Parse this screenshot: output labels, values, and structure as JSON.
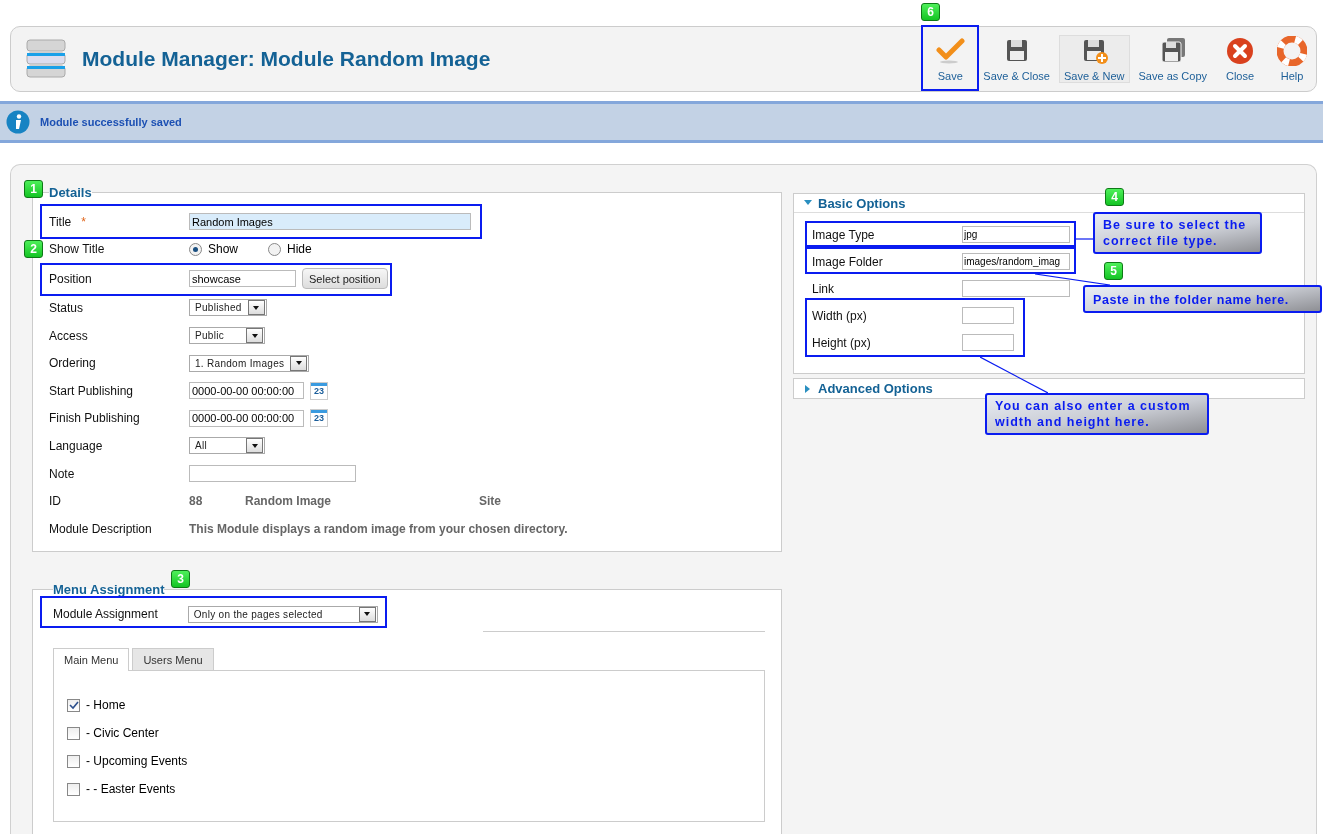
{
  "toolbar": {
    "title": "Module Manager: Module Random Image",
    "buttons": [
      {
        "label": "Save",
        "kind": "save",
        "highlighted": false
      },
      {
        "label": "Save & Close",
        "kind": "save-close",
        "highlighted": false
      },
      {
        "label": "Save & New",
        "kind": "save-new",
        "highlighted": true
      },
      {
        "label": "Save as Copy",
        "kind": "save-copy",
        "highlighted": false
      },
      {
        "label": "Close",
        "kind": "close",
        "highlighted": false
      },
      {
        "label": "Help",
        "kind": "help",
        "highlighted": false
      }
    ]
  },
  "message": {
    "text": "Module successfully saved"
  },
  "details": {
    "legend": "Details",
    "fields": [
      {
        "label": "Title",
        "kind": "text",
        "required_mark": "*",
        "value": "Random Images",
        "focused": true
      },
      {
        "label": "Show Title",
        "kind": "radio",
        "options": [
          {
            "label": "Show",
            "selected": true
          },
          {
            "label": "Hide",
            "selected": false
          }
        ]
      },
      {
        "label": "Position",
        "kind": "text",
        "value": "showcase",
        "button": "Select position"
      },
      {
        "label": "Status",
        "kind": "select",
        "value": "Published"
      },
      {
        "label": "Access",
        "kind": "select",
        "value": "Public"
      },
      {
        "label": "Ordering",
        "kind": "select",
        "value": "1. Random Images"
      },
      {
        "label": "Start Publishing",
        "kind": "date",
        "value": "0000-00-00 00:00:00",
        "calendar_label": "23"
      },
      {
        "label": "Finish Publishing",
        "kind": "date",
        "value": "0000-00-00 00:00:00",
        "calendar_label": "23"
      },
      {
        "label": "Language",
        "kind": "select",
        "value": "All"
      },
      {
        "label": "Note",
        "kind": "text"
      },
      {
        "label": "ID",
        "kind": "info",
        "values": [
          "88",
          "Random Image",
          "Site"
        ]
      },
      {
        "label": "Module Description",
        "kind": "description",
        "value": "This Module displays a random image from your chosen directory."
      }
    ]
  },
  "basic_options": {
    "title": "Basic Options",
    "expanded": true,
    "fields": [
      {
        "label": "Image Type",
        "kind": "text",
        "value": "jpg"
      },
      {
        "label": "Image Folder",
        "kind": "text",
        "value": "images/random_imag"
      },
      {
        "label": "Link",
        "kind": "text"
      },
      {
        "label": "Width (px)",
        "kind": "number"
      },
      {
        "label": "Height (px)",
        "kind": "number"
      }
    ]
  },
  "advanced_options": {
    "title": "Advanced Options",
    "expanded": false
  },
  "menu_assignment": {
    "legend": "Menu Assignment",
    "label": "Module Assignment",
    "value": "Only on the pages selected",
    "tabs": [
      {
        "label": "Main Menu",
        "selected": true
      },
      {
        "label": "Users Menu",
        "selected": false
      }
    ],
    "items": [
      {
        "label": "- Home",
        "checked": true
      },
      {
        "label": "- Civic Center",
        "checked": false
      },
      {
        "label": "- Upcoming Events",
        "checked": false,
        "children": [
          {
            "label": "- - Easter Events",
            "checked": false
          }
        ]
      }
    ]
  },
  "annotations": {
    "badges": [
      "1",
      "2",
      "3",
      "4",
      "5",
      "6"
    ],
    "callouts": [
      "Be sure to select the correct file type.",
      "Paste in the folder name here.",
      "You can also enter a custom width and height here."
    ]
  }
}
